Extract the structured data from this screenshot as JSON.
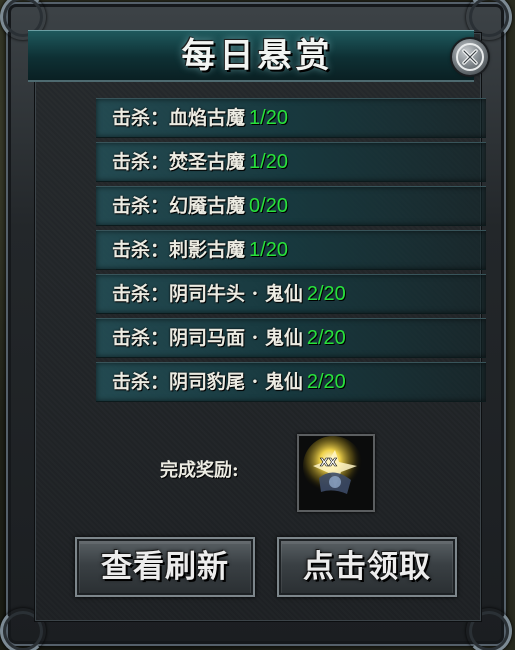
{
  "dialog": {
    "title": "每日悬赏"
  },
  "tasks": [
    {
      "label": "击杀：血焰古魔",
      "progress": "1/20"
    },
    {
      "label": "击杀：焚圣古魔",
      "progress": "1/20"
    },
    {
      "label": "击杀：幻魇古魔",
      "progress": "0/20"
    },
    {
      "label": "击杀：刺影古魔",
      "progress": "1/20"
    },
    {
      "label": "击杀：阴司牛头 · 鬼仙",
      "progress": "2/20"
    },
    {
      "label": "击杀：阴司马面 · 鬼仙",
      "progress": "2/20"
    },
    {
      "label": "击杀：阴司豹尾 · 鬼仙",
      "progress": "2/20"
    }
  ],
  "reward": {
    "label": "完成奖励:",
    "item_icon": "glowing-treasure-item-icon"
  },
  "buttons": {
    "refresh_label": "查看刷新",
    "claim_label": "点击领取"
  },
  "colors": {
    "progress": "#28e23c",
    "title_bar": "#1f5a5e",
    "text": "#ecebe2"
  }
}
